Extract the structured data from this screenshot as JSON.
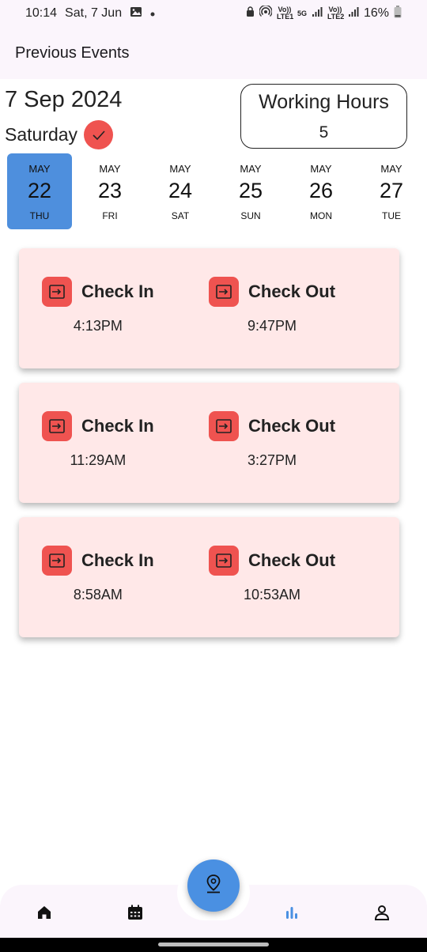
{
  "status_bar": {
    "time": "10:14",
    "date": "Sat, 7 Jun",
    "battery": "16%",
    "net_5g": "5G",
    "volte1": "Vo)) LTE1",
    "volte2": "Vo)) LTE2"
  },
  "app_bar": {
    "title": "Previous Events"
  },
  "header": {
    "date": "7 Sep 2024",
    "weekday": "Saturday",
    "working_hours_label": "Working Hours",
    "working_hours_value": "5"
  },
  "date_strip": [
    {
      "month": "MAY",
      "day": "22",
      "weekday": "THU",
      "selected": true
    },
    {
      "month": "MAY",
      "day": "23",
      "weekday": "FRI",
      "selected": false
    },
    {
      "month": "MAY",
      "day": "24",
      "weekday": "SAT",
      "selected": false
    },
    {
      "month": "MAY",
      "day": "25",
      "weekday": "SUN",
      "selected": false
    },
    {
      "month": "MAY",
      "day": "26",
      "weekday": "MON",
      "selected": false
    },
    {
      "month": "MAY",
      "day": "27",
      "weekday": "TUE",
      "selected": false
    }
  ],
  "events": [
    {
      "check_in_label": "Check In",
      "check_in_time": "4:13PM",
      "check_out_label": "Check Out",
      "check_out_time": "9:47PM"
    },
    {
      "check_in_label": "Check In",
      "check_in_time": "11:29AM",
      "check_out_label": "Check Out",
      "check_out_time": "3:27PM"
    },
    {
      "check_in_label": "Check In",
      "check_in_time": "8:58AM",
      "check_out_label": "Check Out",
      "check_out_time": "10:53AM"
    }
  ],
  "bottom_nav": {
    "items": [
      "home-icon",
      "calendar-icon",
      "stats-icon",
      "profile-icon"
    ],
    "fab_icon": "location-pin-icon",
    "active": "stats-icon"
  },
  "colors": {
    "accent_blue": "#4a90e2",
    "selected_date": "#4e8fdd",
    "card_bg": "#ffe8e8",
    "icon_red": "#ef5350",
    "bar_bg": "#fbf5fc"
  }
}
